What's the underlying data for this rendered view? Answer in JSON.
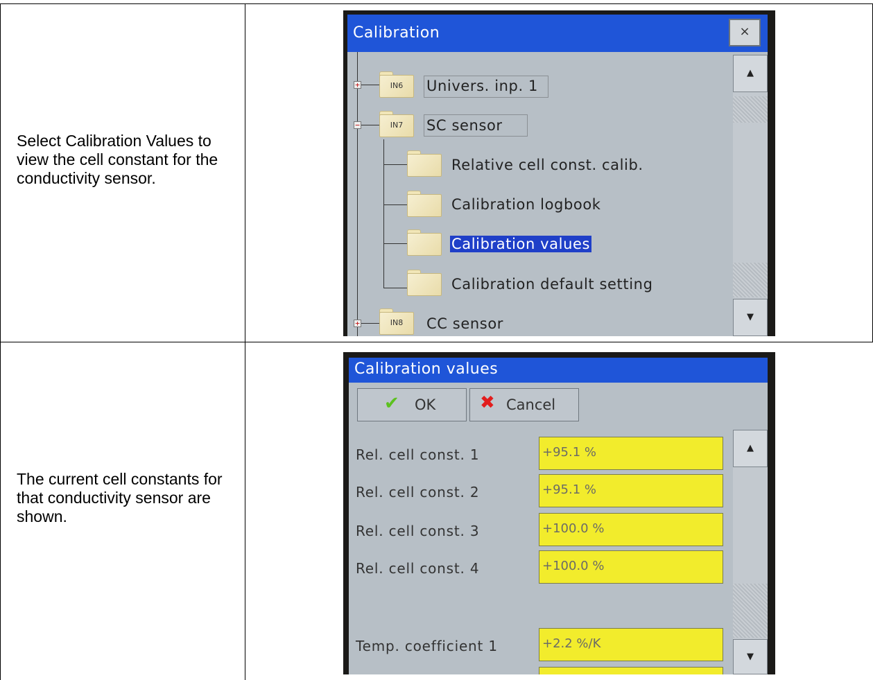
{
  "rows": [
    {
      "instruction": "Select Calibration Values to view the cell constant for the conductivity sensor.",
      "screen": {
        "title": "Calibration",
        "close_symbol": "×",
        "tree": [
          {
            "folder_label": "IN6",
            "label": "Univers. inp. 1",
            "expander": "+"
          },
          {
            "folder_label": "IN7",
            "label": "SC sensor",
            "expander": "−"
          },
          {
            "label": "Relative cell const. calib."
          },
          {
            "label": "Calibration logbook"
          },
          {
            "label": "Calibration values",
            "selected": true
          },
          {
            "label": "Calibration default setting"
          },
          {
            "folder_label": "IN8",
            "label": "CC sensor",
            "expander": "+"
          }
        ],
        "scroll_up": "▲",
        "scroll_down": "▼"
      }
    },
    {
      "instruction": "The current cell constants for that conductivity sensor are shown.",
      "screen": {
        "title": "Calibration values",
        "ok_label": "OK",
        "cancel_label": "Cancel",
        "ok_icon": "checkmark-icon",
        "cancel_icon": "x-icon",
        "fields": [
          {
            "label": "Rel. cell const. 1",
            "value": "+95.1 %"
          },
          {
            "label": "Rel. cell const. 2",
            "value": "+95.1 %"
          },
          {
            "label": "Rel. cell const. 3",
            "value": "+100.0 %"
          },
          {
            "label": "Rel. cell const. 4",
            "value": "+100.0 %"
          },
          {
            "label": "Temp. coefficient 1",
            "value": "+2.2 %/K"
          }
        ],
        "scroll_up": "▲",
        "scroll_down": "▼"
      }
    }
  ],
  "colors": {
    "titlebar": "#1f55d8",
    "selection": "#1f3fc8",
    "value_field": "#f2ec2c",
    "screen_bg": "#b7bfc6"
  }
}
